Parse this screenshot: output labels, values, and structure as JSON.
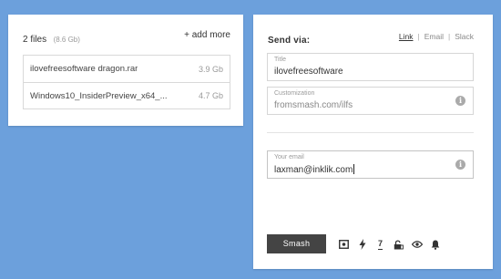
{
  "files_panel": {
    "count_label": "2 files",
    "total_size": "(8.6 Gb)",
    "add_more_label": "+ add more",
    "files": [
      {
        "name": "ilovefreesoftware dragon.rar",
        "size": "3.9 Gb"
      },
      {
        "name": "Windows10_InsiderPreview_x64_...",
        "size": "4.7 Gb"
      }
    ]
  },
  "send_panel": {
    "title": "Send via:",
    "tabs": {
      "link": "Link",
      "email": "Email",
      "slack": "Slack",
      "separator": "|",
      "active": "link"
    },
    "title_field": {
      "label": "Title",
      "value": "ilovefreesoftware"
    },
    "customization_field": {
      "label": "Customization",
      "value": "fromsmash.com/ilfs"
    },
    "email_field": {
      "label": "Your email",
      "value": "laxman@inklik.com"
    },
    "info_glyph": "i",
    "smash_button": "Smash",
    "options": {
      "icons": [
        "preview-icon",
        "flash-icon",
        "expiry-icon",
        "lock-icon",
        "eye-icon",
        "bell-icon"
      ],
      "expiry_value": "7"
    }
  },
  "colors": {
    "background": "#6ca0dc",
    "card": "#ffffff",
    "button": "#444444"
  }
}
